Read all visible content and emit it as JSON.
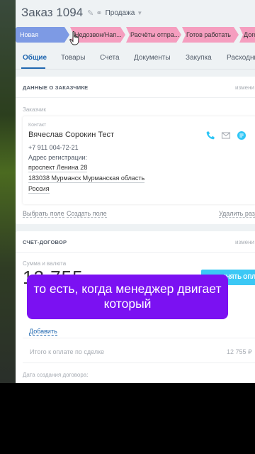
{
  "header": {
    "title": "Заказ 1094",
    "category": "Продажа"
  },
  "stages": [
    "Новая",
    "Недозвон/Нап...",
    "Расчёты отпра...",
    "Готов работать",
    "Догов"
  ],
  "tabs": [
    "Общие",
    "Товары",
    "Счета",
    "Документы",
    "Закупка",
    "Расходни"
  ],
  "customer": {
    "section_title": "ДАННЫЕ О ЗАКАЗЧИКЕ",
    "section_action": "измени",
    "customer_label": "Заказчик",
    "contact_label": "Контакт",
    "name": "Вячеслав Сорокин Тест",
    "phone": "+7 911 004-72-21",
    "address_label": "Адрес регистрации:",
    "address_lines": [
      "проспект Ленина 28",
      "183038 Мурманск Мурманская область",
      "Россия"
    ],
    "select_field": "Выбрать поле",
    "create_field": "Создать поле",
    "delete_section": "Удалить разд"
  },
  "contract": {
    "section_title": "СЧЕТ-ДОГОВОР",
    "section_action": "измени",
    "sum_label": "Сумма и валюта",
    "sum_value": "12 755",
    "pay_button": "ПРИНЯТЬ ОПЛАТУ",
    "add_link": "Добавить",
    "due_label": "Итого к оплате по сделке",
    "due_value": "12 755 ₽",
    "date_label": "Дата создания договора:"
  },
  "caption": "то есть, когда менеджер двигает который",
  "colors": {
    "accent": "#2067b0",
    "stage_active": "#7d9ae4",
    "stage_pending": "#f59ebf",
    "pay_button": "#3bc8f5",
    "caption_bg": "#7b11f2"
  }
}
